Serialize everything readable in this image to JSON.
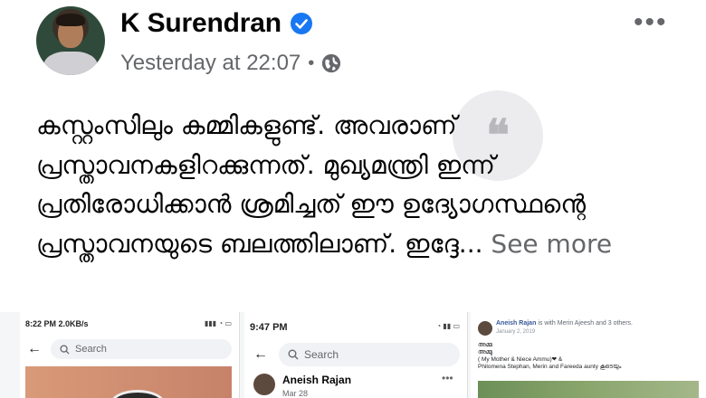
{
  "post": {
    "author": "K Surendran",
    "timestamp": "Yesterday at 22:07",
    "separator": "•",
    "more_label": "•••",
    "text": "കസ്റ്റംസിലും കമ്മികളുണ്ട്. അവരാണ് പ്രസ്താവനകളിറക്കുന്നത്. മുഖ്യമന്ത്രി ഇന്ന് പ്രതിരോധിക്കാൻ ശ്രമിച്ചത് ഈ ഉദ്യോഗസ്ഥന്റെ പ്രസ്താവനയുടെ ബലത്തിലാണ്. ഇദ്ദേ...",
    "see_more": "See more",
    "icons": {
      "verified": "verified-badge-icon",
      "privacy": "globe-icon",
      "more": "more-options-icon"
    },
    "colors": {
      "verified": "#1877f2",
      "meta": "#65676b"
    }
  },
  "screenshots": {
    "left": {
      "status_time": "8:22 PM",
      "status_speed": "2.0KB/s",
      "search_placeholder": "Search"
    },
    "middle": {
      "status_time": "9:47 PM",
      "search_placeholder": "Search",
      "profile_name": "Aneish Rajan",
      "profile_date": "Mar 28",
      "more_label": "•••"
    },
    "right": {
      "author": "Aneish Rajan",
      "with_text": "is with Merin Ajeesh and 3 others.",
      "date": "January 2, 2019",
      "line1": "അമ്മ",
      "line2": "അമ്മു",
      "line3": "( My Mother & Niece Ammu)❤ &",
      "line4": "Philomena Stephan, Merin and Fareeda aunty കൂടെയും"
    }
  }
}
